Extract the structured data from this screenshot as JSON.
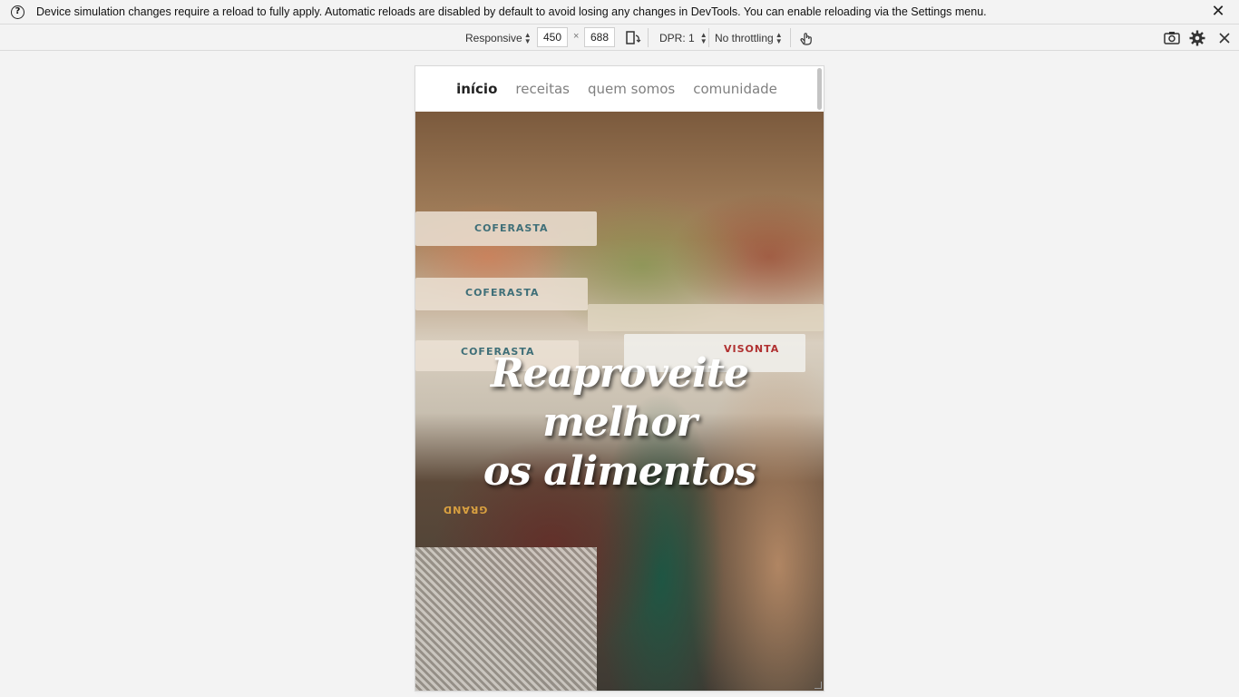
{
  "infobar": {
    "message": "Device simulation changes require a reload to fully apply. Automatic reloads are disabled by default to avoid losing any changes in DevTools. You can enable reloading via the Settings menu.",
    "help_icon": "?",
    "close_icon": "✕"
  },
  "toolbar": {
    "mode": "Responsive",
    "width": "450",
    "height": "688",
    "times": "×",
    "dpr": "DPR: 1",
    "throttling": "No throttling"
  },
  "page": {
    "nav": [
      {
        "label": "início",
        "active": true
      },
      {
        "label": "receitas",
        "active": false
      },
      {
        "label": "quem somos",
        "active": false
      },
      {
        "label": "comunidade",
        "active": false
      }
    ],
    "hero": {
      "title_line1": "Reaproveite melhor",
      "title_line2": "os alimentos",
      "crate_labels": [
        "COFERASTA",
        "COFERASTA",
        "COFERASTA",
        "VISONTA",
        "GRAND"
      ]
    }
  }
}
